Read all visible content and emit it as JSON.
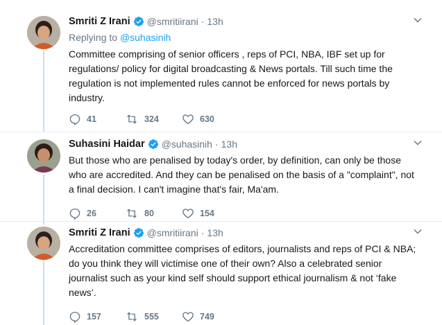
{
  "tweets": [
    {
      "name": "Smriti Z Irani",
      "handle": "@smritiirani",
      "dot": "·",
      "time": "13h",
      "reply_prefix": "Replying to ",
      "reply_handle": "@suhasinih",
      "text": "Committee comprising of senior officers , reps of PCI, NBA, IBF set up for regulations/ policy for digital broadcasting & News portals. Till such time the regulation is not implemented rules cannot be enforced for news portals by industry.",
      "replies": "41",
      "retweets": "324",
      "likes": "630"
    },
    {
      "name": "Suhasini Haidar",
      "handle": "@suhasinih",
      "dot": "·",
      "time": "13h",
      "text": "But those who are penalised by today's order, by definition, can only be those who are accredited. And they can be penalised on the basis of a \"complaint\", not a final decision. I can't imagine that's fair, Ma'am.",
      "replies": "26",
      "retweets": "80",
      "likes": "154"
    },
    {
      "name": "Smriti Z Irani",
      "handle": "@smritiirani",
      "dot": "·",
      "time": "13h",
      "text": "Accreditation committee comprises of editors, journalists and reps of PCI & NBA; do you think they will victimise one of their own? Also a celebrated senior journalist such as your kind self should support ethical journalism & not ‘fake news’.",
      "replies": "157",
      "retweets": "555",
      "likes": "749"
    }
  ],
  "colors": {
    "accent": "#1da1f2",
    "muted": "#657786",
    "thread": "#c4e0f5"
  },
  "icons": [
    "verified-badge-icon",
    "chevron-down-icon",
    "reply-icon",
    "retweet-icon",
    "like-icon"
  ]
}
